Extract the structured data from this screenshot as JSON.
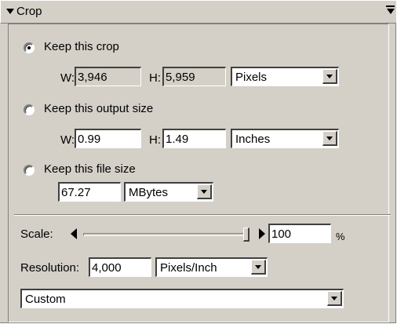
{
  "panel": {
    "title": "Crop"
  },
  "keep_crop": {
    "label": "Keep this crop",
    "selected": true,
    "w_label": "W:",
    "w_value": "3,946",
    "h_label": "H:",
    "h_value": "5,959",
    "unit": "Pixels"
  },
  "keep_output": {
    "label": "Keep this output size",
    "selected": false,
    "w_label": "W:",
    "w_value": "0.99",
    "h_label": "H:",
    "h_value": "1.49",
    "unit": "Inches"
  },
  "keep_file": {
    "label": "Keep this file size",
    "selected": false,
    "value": "67.27",
    "unit": "MBytes"
  },
  "scale": {
    "label": "Scale:",
    "value": "100",
    "suffix": "%",
    "slider_fraction": 1.0
  },
  "resolution": {
    "label": "Resolution:",
    "value": "4,000",
    "unit": "Pixels/Inch"
  },
  "preset": {
    "value": "Custom"
  }
}
